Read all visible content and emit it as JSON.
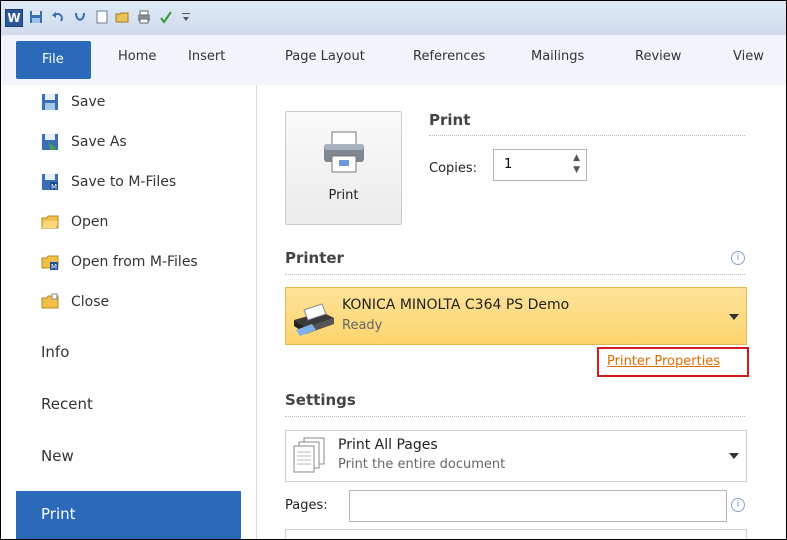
{
  "ribbon": {
    "tabs": [
      {
        "label": "File"
      },
      {
        "label": "Home"
      },
      {
        "label": "Insert"
      },
      {
        "label": "Page Layout"
      },
      {
        "label": "References"
      },
      {
        "label": "Mailings"
      },
      {
        "label": "Review"
      },
      {
        "label": "View"
      }
    ]
  },
  "nav": {
    "items": [
      {
        "label": "Save",
        "icon": "save-icon"
      },
      {
        "label": "Save As",
        "icon": "save-as-icon"
      },
      {
        "label": "Save to M-Files",
        "icon": "save-to-mfiles-icon"
      },
      {
        "label": "Open",
        "icon": "open-folder-icon"
      },
      {
        "label": "Open from M-Files",
        "icon": "open-from-mfiles-icon"
      },
      {
        "label": "Close",
        "icon": "close-folder-icon"
      }
    ],
    "sections": [
      {
        "label": "Info"
      },
      {
        "label": "Recent"
      },
      {
        "label": "New"
      },
      {
        "label": "Print"
      }
    ]
  },
  "print": {
    "section_title": "Print",
    "button_label": "Print",
    "copies_label": "Copies:",
    "copies_value": "1"
  },
  "printer": {
    "section_title": "Printer",
    "name": "KONICA MINOLTA C364 PS Demo",
    "status": "Ready",
    "properties_link": "Printer Properties"
  },
  "settings": {
    "section_title": "Settings",
    "print_scope": "Print All Pages",
    "print_scope_desc": "Print the entire document",
    "pages_label": "Pages:",
    "pages_value": ""
  },
  "colors": {
    "file_tab": "#2a6ab8",
    "printer_highlight": "#fbd46c",
    "callout_border": "#d51c1c",
    "link": "#e06b00"
  }
}
